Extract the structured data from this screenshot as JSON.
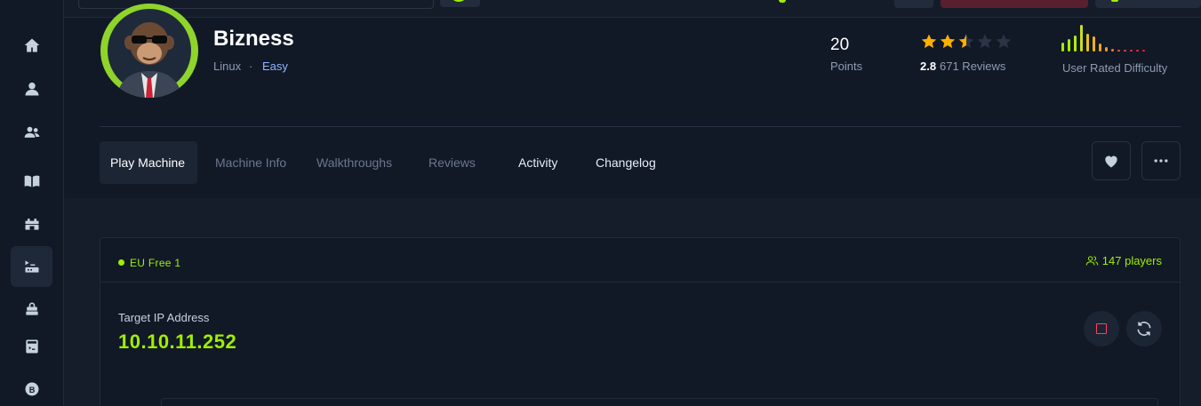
{
  "sidebar": {
    "items": [
      {
        "icon": "home-icon"
      },
      {
        "icon": "user-icon"
      },
      {
        "icon": "users-icon"
      },
      {
        "icon": "book-icon"
      },
      {
        "icon": "castle-icon"
      },
      {
        "icon": "terminal-server-icon",
        "active": true
      },
      {
        "icon": "lock-server-icon"
      },
      {
        "icon": "code-file-icon"
      },
      {
        "icon": "b-coin-icon"
      }
    ]
  },
  "machine": {
    "name": "Bizness",
    "os": "Linux",
    "separator": "·",
    "difficulty": "Easy",
    "points_value": "20",
    "points_label": "Points",
    "rating": "2.8",
    "rating_stars": 2.5,
    "reviews": "671 Reviews",
    "difficulty_label": "User Rated Difficulty"
  },
  "tabs": [
    {
      "label": "Play Machine",
      "state": "active"
    },
    {
      "label": "Machine Info",
      "state": "muted"
    },
    {
      "label": "Walkthroughs",
      "state": "muted"
    },
    {
      "label": "Reviews",
      "state": "muted"
    },
    {
      "label": "Activity",
      "state": "normal"
    },
    {
      "label": "Changelog",
      "state": "normal"
    }
  ],
  "actions": {
    "favorite_icon": "heart-icon",
    "more_icon": "more-icon"
  },
  "play": {
    "server": "EU Free 1",
    "players": "147 players",
    "ip_label": "Target IP Address",
    "ip": "10.10.11.252"
  },
  "colors": {
    "accent": "#9fef00",
    "danger": "#ff3e5e",
    "easy": "#8fb6ff",
    "star": "#ffaf00"
  }
}
